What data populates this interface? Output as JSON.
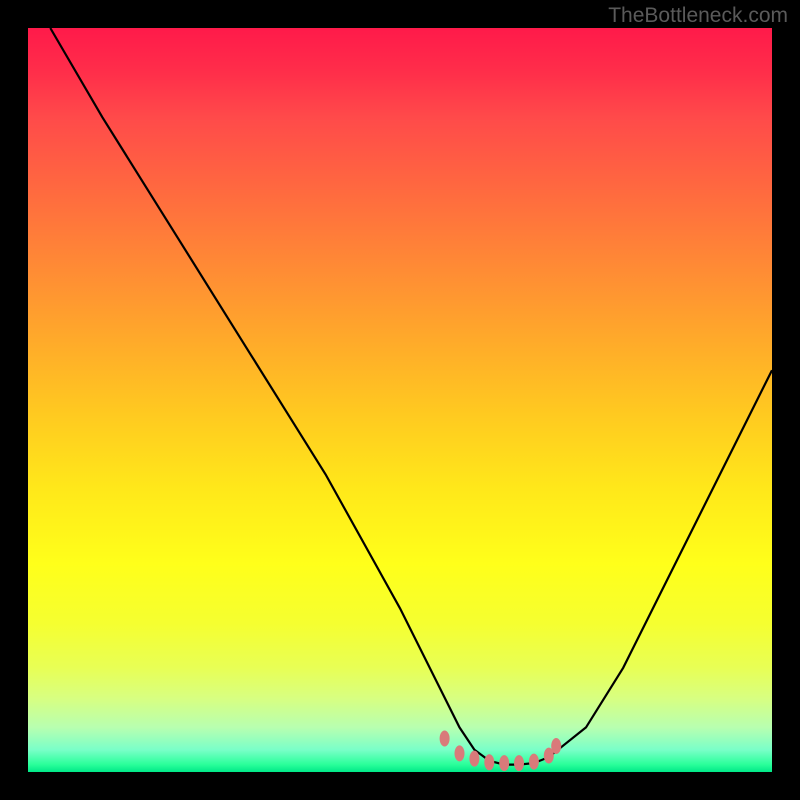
{
  "watermark": "TheBottleneck.com",
  "chart_data": {
    "type": "line",
    "title": "",
    "xlabel": "",
    "ylabel": "",
    "xlim": [
      0,
      100
    ],
    "ylim": [
      0,
      100
    ],
    "series": [
      {
        "name": "bottleneck-curve",
        "x": [
          3,
          10,
          20,
          30,
          40,
          50,
          55,
          58,
          60,
          62,
          64,
          66,
          68,
          70,
          75,
          80,
          85,
          90,
          95,
          100
        ],
        "y": [
          100,
          88,
          72,
          56,
          40,
          22,
          12,
          6,
          3,
          1.5,
          1,
          1,
          1.2,
          2,
          6,
          14,
          24,
          34,
          44,
          54
        ]
      }
    ],
    "markers": {
      "name": "flat-region-dots",
      "color": "#d97a7a",
      "x": [
        56,
        58,
        60,
        62,
        64,
        66,
        68,
        70,
        71
      ],
      "y": [
        4.5,
        2.5,
        1.8,
        1.3,
        1.2,
        1.2,
        1.4,
        2.2,
        3.5
      ]
    },
    "gradient_stops": [
      {
        "pos": 0,
        "color": "#ff1a4a"
      },
      {
        "pos": 50,
        "color": "#ffca20"
      },
      {
        "pos": 80,
        "color": "#f5ff30"
      },
      {
        "pos": 100,
        "color": "#00e888"
      }
    ]
  }
}
